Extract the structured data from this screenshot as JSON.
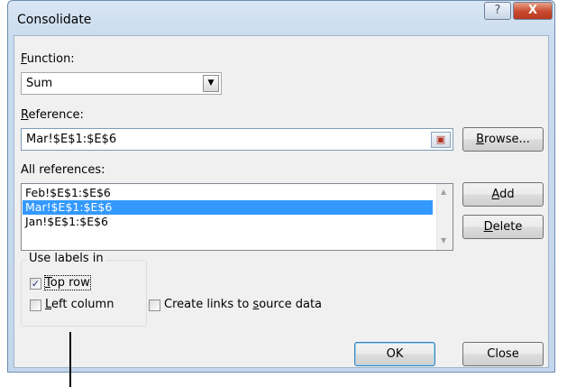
{
  "dialog": {
    "title": "Consolidate",
    "help_glyph": "?",
    "close_glyph": "X"
  },
  "function": {
    "label_u": "F",
    "label_rest": "unction:",
    "value": "Sum",
    "dropdown_glyph": "▼"
  },
  "reference": {
    "label_u": "R",
    "label_rest": "eference:",
    "value": "Mar!$E$1:$E$6",
    "collapse_glyph": "▣"
  },
  "all_references": {
    "label": "All references:",
    "items": [
      "Feb!$E$1:$E$6",
      "Mar!$E$1:$E$6",
      "Jan!$E$1:$E$6"
    ],
    "selected_index": 1
  },
  "buttons": {
    "browse_u": "B",
    "browse_rest": "rowse...",
    "add_u": "A",
    "add_rest": "dd",
    "delete_u": "D",
    "delete_rest": "elete",
    "ok": "OK",
    "close": "Close"
  },
  "labels_group": {
    "title": "Use labels in",
    "top_row_u": "T",
    "top_row_rest": "op row",
    "top_row_checked": true,
    "left_column_u": "L",
    "left_column_rest": "eft column",
    "left_column_checked": false
  },
  "links": {
    "pre": "Create links to ",
    "u": "s",
    "post": "ource data",
    "checked": false
  },
  "check_glyph": "✓"
}
